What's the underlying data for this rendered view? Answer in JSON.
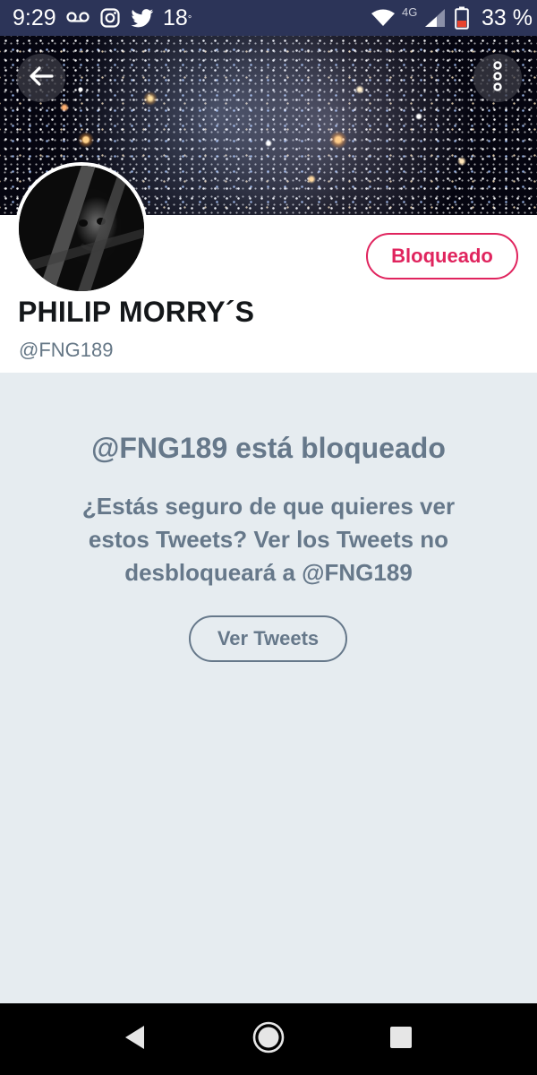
{
  "status_bar": {
    "time": "9:29",
    "temperature": "18",
    "temperature_unit": "°",
    "network": "4G",
    "battery": "33 %",
    "icons": [
      "voicemail-icon",
      "instagram-icon",
      "twitter-icon",
      "wifi-icon",
      "signal-icon",
      "battery-icon"
    ]
  },
  "header": {
    "back_icon": "arrow-left-icon",
    "more_icon": "more-vertical-icon"
  },
  "profile": {
    "display_name": "PHILIP MORRY´S",
    "handle": "@FNG189",
    "blocked_button_label": "Bloqueado"
  },
  "blocked_notice": {
    "title": "@FNG189 está bloqueado",
    "message": "¿Estás seguro de que quieres ver estos Tweets? Ver los Tweets no desbloqueará a @FNG189",
    "view_button_label": "Ver Tweets"
  },
  "nav": {
    "icons": [
      "nav-back-icon",
      "nav-home-icon",
      "nav-recents-icon"
    ]
  },
  "colors": {
    "status_bar": "#2c3458",
    "accent_blocked": "#e0245e",
    "text_primary": "#14171a",
    "text_secondary": "#657786",
    "content_bg": "#e6ecf0"
  }
}
